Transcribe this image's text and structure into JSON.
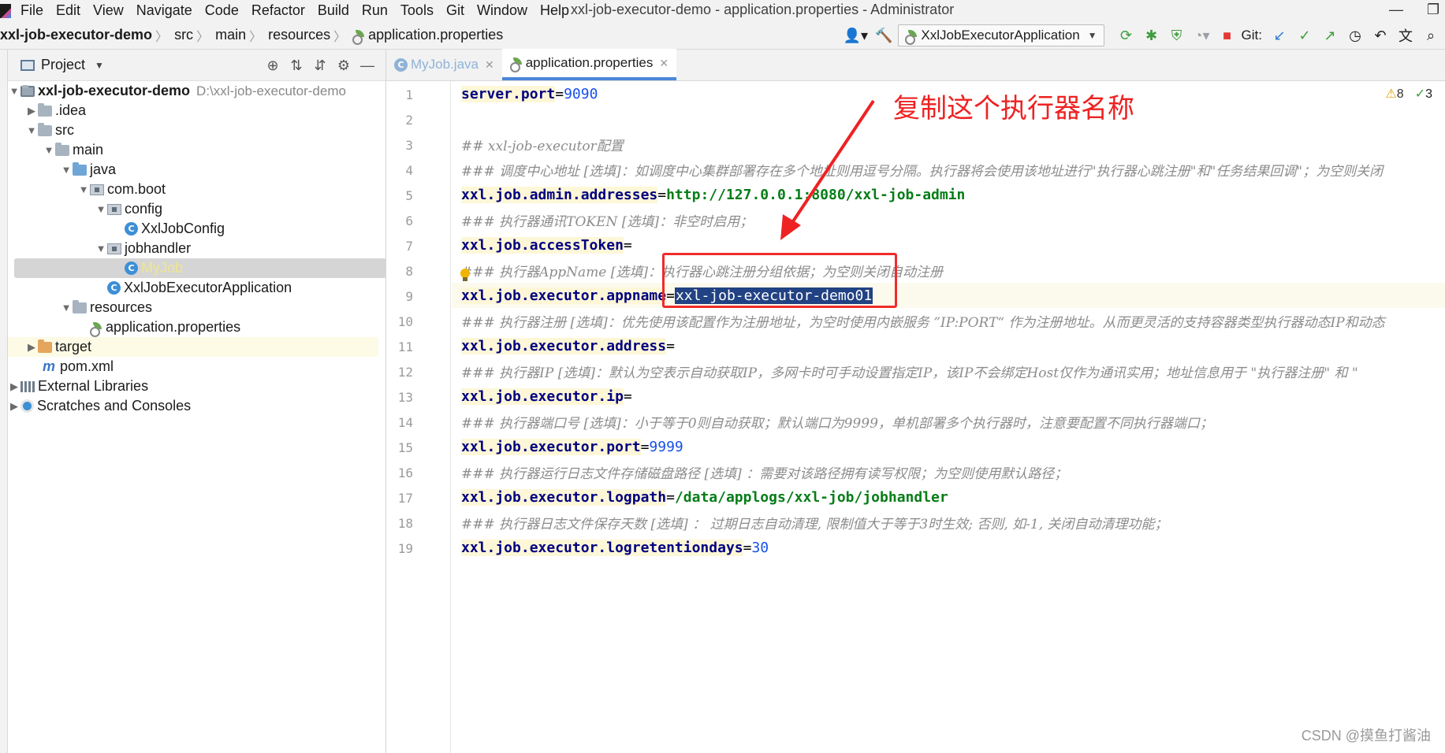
{
  "window": {
    "title": "xxl-job-executor-demo - application.properties - Administrator"
  },
  "menu": [
    "File",
    "Edit",
    "View",
    "Navigate",
    "Code",
    "Refactor",
    "Build",
    "Run",
    "Tools",
    "Git",
    "Window",
    "Help"
  ],
  "breadcrumb": [
    "xxl-job-executor-demo",
    "src",
    "main",
    "resources",
    "application.properties"
  ],
  "toolbar": {
    "run_config": "XxlJobExecutorApplication",
    "git_label": "Git:"
  },
  "project_panel": {
    "title": "Project",
    "tree": [
      {
        "label": "xxl-job-executor-demo",
        "path": "D:\\xxl-job-executor-demo"
      },
      {
        "label": ".idea"
      },
      {
        "label": "src"
      },
      {
        "label": "main"
      },
      {
        "label": "java"
      },
      {
        "label": "com.boot"
      },
      {
        "label": "config"
      },
      {
        "label": "XxlJobConfig"
      },
      {
        "label": "jobhandler"
      },
      {
        "label": "MyJob"
      },
      {
        "label": "XxlJobExecutorApplication"
      },
      {
        "label": "resources"
      },
      {
        "label": "application.properties"
      },
      {
        "label": "target"
      },
      {
        "label": "pom.xml"
      },
      {
        "label": "External Libraries"
      },
      {
        "label": "Scratches and Consoles"
      }
    ]
  },
  "editor": {
    "tabs": [
      "MyJob.java",
      "application.properties"
    ],
    "warnings": "8",
    "checks": "3",
    "line_numbers": [
      "1",
      "2",
      "3",
      "4",
      "5",
      "6",
      "7",
      "8",
      "9",
      "10",
      "11",
      "12",
      "13",
      "14",
      "15",
      "16",
      "17",
      "18",
      "19"
    ],
    "lines": [
      {
        "key": "server.port",
        "value": "9090"
      },
      {},
      {
        "comment": "## xxl-job-executor配置"
      },
      {
        "comment": "### 调度中心地址 [选填]：如调度中心集群部署存在多个地址则用逗号分隔。执行器将会使用该地址进行\"执行器心跳注册\"和\"任务结果回调\"；为空则关闭"
      },
      {
        "key": "xxl.job.admin.addresses",
        "value": "http://127.0.0.1:8080/xxl-job-admin"
      },
      {
        "comment": "### 执行器通讯TOKEN [选填]：非空时启用；"
      },
      {
        "key": "xxl.job.accessToken",
        "value": ""
      },
      {
        "comment": "### 执行器AppName [选填]：执行器心跳注册分组依据；为空则关闭自动注册"
      },
      {
        "key": "xxl.job.executor.appname",
        "value": "xxl-job-executor-demo01"
      },
      {
        "comment": "### 执行器注册 [选填]：优先使用该配置作为注册地址，为空时使用内嵌服务 ”IP:PORT“ 作为注册地址。从而更灵活的支持容器类型执行器动态IP和动态"
      },
      {
        "key": "xxl.job.executor.address",
        "value": ""
      },
      {
        "comment": "### 执行器IP [选填]：默认为空表示自动获取IP，多网卡时可手动设置指定IP，该IP不会绑定Host仅作为通讯实用；地址信息用于 \"执行器注册\" 和 \""
      },
      {
        "key": "xxl.job.executor.ip",
        "value": ""
      },
      {
        "comment": "### 执行器端口号 [选填]：小于等于0则自动获取；默认端口为9999，单机部署多个执行器时，注意要配置不同执行器端口；"
      },
      {
        "key": "xxl.job.executor.port",
        "value": "9999"
      },
      {
        "comment": "### 执行器运行日志文件存储磁盘路径 [选填] ：需要对该路径拥有读写权限；为空则使用默认路径；"
      },
      {
        "key": "xxl.job.executor.logpath",
        "value": "/data/applogs/xxl-job/jobhandler"
      },
      {
        "comment": "### 执行器日志文件保存天数 [选填] ： 过期日志自动清理, 限制值大于等于3时生效; 否则, 如-1, 关闭自动清理功能；"
      },
      {
        "key": "xxl.job.executor.logretentiondays",
        "value": "30"
      }
    ]
  },
  "annotation": {
    "text": "复制这个执行器名称",
    "color": "#ee2222"
  },
  "watermark": "CSDN @摸鱼打酱油",
  "colors": {
    "selection": "#214283",
    "key": "#000080",
    "string": "#067d17",
    "number": "#1750eb",
    "comment": "#8c8c8c"
  }
}
